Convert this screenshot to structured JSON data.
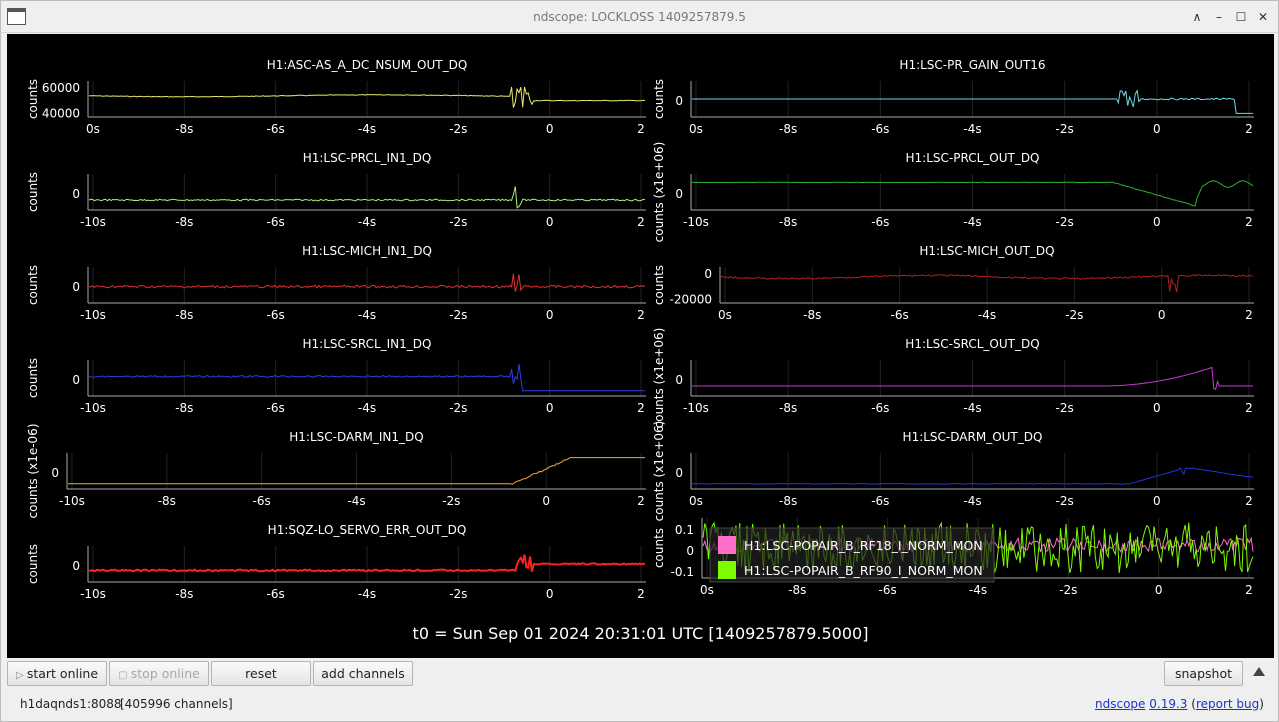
{
  "window": {
    "title": "ndscope: LOCKLOSS 1409257879.5",
    "controls": [
      "∧",
      "–",
      "☐",
      "✕"
    ]
  },
  "units": {
    "counts": "counts",
    "counts_scaled": "counts (x1e-06)",
    "counts_scaled_up": "counts (x1e+06)"
  },
  "plots": [
    {
      "title": "H1:ASC-AS_A_DC_NSUM_OUT_DQ",
      "ylabel": "counts",
      "yticks": [
        "60000",
        "40000"
      ],
      "xticks": [
        "0s",
        "-8s",
        "-6s",
        "-4s",
        "-2s",
        "0",
        "2"
      ],
      "color": "#e8e86a"
    },
    {
      "title": "H1:LSC-PR_GAIN_OUT16",
      "ylabel": "counts",
      "yticks": [
        "0"
      ],
      "xticks": [
        "0s",
        "-8s",
        "-6s",
        "-4s",
        "-2s",
        "0",
        "2"
      ],
      "color": "#6fd8e6"
    },
    {
      "title": "H1:LSC-PRCL_IN1_DQ",
      "ylabel": "counts",
      "yticks": [
        "0"
      ],
      "xticks": [
        "-10s",
        "-8s",
        "-6s",
        "-4s",
        "-2s",
        "0",
        "2"
      ],
      "color": "#a6f07a"
    },
    {
      "title": "H1:LSC-PRCL_OUT_DQ",
      "ylabel": "counts (x1e+06)",
      "yticks": [
        "0"
      ],
      "xticks": [
        "-10s",
        "-8s",
        "-6s",
        "-4s",
        "-2s",
        "0",
        "2"
      ],
      "color": "#2fb02f"
    },
    {
      "title": "H1:LSC-MICH_IN1_DQ",
      "ylabel": "counts",
      "yticks": [
        "0"
      ],
      "xticks": [
        "-10s",
        "-8s",
        "-6s",
        "-4s",
        "-2s",
        "0",
        "2"
      ],
      "color": "#e03030"
    },
    {
      "title": "H1:LSC-MICH_OUT_DQ",
      "ylabel": "counts",
      "yticks": [
        "0",
        "-20000"
      ],
      "xticks": [
        "0s",
        "-8s",
        "-6s",
        "-4s",
        "-2s",
        "0",
        "2"
      ],
      "color": "#b22020"
    },
    {
      "title": "H1:LSC-SRCL_IN1_DQ",
      "ylabel": "counts",
      "yticks": [
        "0"
      ],
      "xticks": [
        "-10s",
        "-8s",
        "-6s",
        "-4s",
        "-2s",
        "0",
        "2"
      ],
      "color": "#2b3fe8"
    },
    {
      "title": "H1:LSC-SRCL_OUT_DQ",
      "ylabel": "counts (x1e+06)",
      "yticks": [
        "0"
      ],
      "xticks": [
        "-10s",
        "-8s",
        "-6s",
        "-4s",
        "-2s",
        "0",
        "2"
      ],
      "color": "#c63ad6"
    },
    {
      "title": "H1:LSC-DARM_IN1_DQ",
      "ylabel": "counts (x1e-06)",
      "yticks": [
        "0"
      ],
      "xticks": [
        "-10s",
        "-8s",
        "-6s",
        "-4s",
        "-2s",
        "0",
        "2"
      ],
      "color": "#f2a838"
    },
    {
      "title": "H1:LSC-DARM_OUT_DQ",
      "ylabel": "counts (x1e+06)",
      "yticks": [
        "0"
      ],
      "xticks": [
        "0s",
        "-8s",
        "-6s",
        "-4s",
        "-2s",
        "0",
        "2"
      ],
      "color": "#2233e0"
    },
    {
      "title": "H1:SQZ-LO_SERVO_ERR_OUT_DQ",
      "ylabel": "counts",
      "yticks": [
        "0"
      ],
      "xticks": [
        "-10s",
        "-8s",
        "-6s",
        "-4s",
        "-2s",
        "0",
        "2"
      ],
      "color": "#ff2020"
    },
    {
      "title": "",
      "ylabel": "counts",
      "yticks": [
        "0.1",
        "0",
        "-0.1"
      ],
      "xticks": [
        "0s",
        "-8s",
        "-6s",
        "-4s",
        "-2s",
        "0",
        "2"
      ],
      "color": "#ff6ec7"
    }
  ],
  "legend": [
    {
      "label": "H1:LSC-POPAIR_B_RF18_I_NORM_MON",
      "color": "#ff6ec7"
    },
    {
      "label": "H1:LSC-POPAIR_B_RF90_I_NORM_MON",
      "color": "#7cfc00"
    }
  ],
  "t0": "t0 = Sun Sep 01 2024 20:31:01 UTC [1409257879.5000]",
  "buttons": {
    "start_online": "start online",
    "stop_online": "stop online",
    "reset": "reset",
    "add_channels": "add channels",
    "snapshot": "snapshot"
  },
  "status": {
    "server": "h1daqnds1:8088",
    "channels": "[405996 channels]",
    "app": "ndscope",
    "version": "0.19.3",
    "paren_open": "(",
    "report_bug": "report bug",
    "paren_close": ")"
  }
}
